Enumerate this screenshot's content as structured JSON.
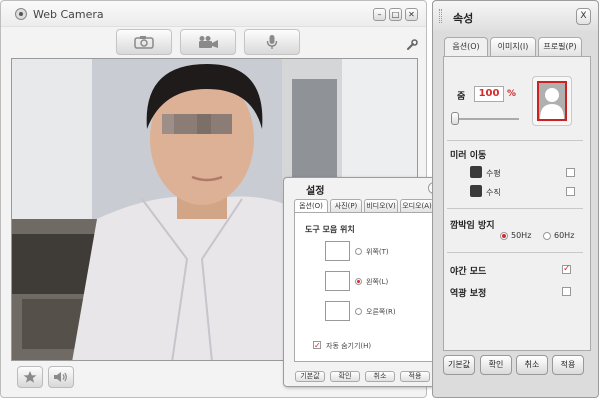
{
  "webcam": {
    "title": "Web Camera",
    "window_buttons": [
      "–",
      "□",
      "✕"
    ],
    "toolbar": {
      "capture_icon": "camera-icon",
      "record_icon": "video-camera-icon",
      "mic_icon": "microphone-icon"
    },
    "settings_icon": "wrench-icon",
    "bottom": {
      "favorite_icon": "star-icon",
      "volume_icon": "speaker-icon"
    }
  },
  "settings": {
    "title": "설정",
    "close": "✕",
    "tabs": [
      "옵션(O)",
      "사진(P)",
      "비디오(V)",
      "오디오(A)"
    ],
    "section": "도구 모음 위치",
    "positions": [
      "위쪽(T)",
      "왼쪽(L)",
      "오른쪽(R)"
    ],
    "selected_position": "왼쪽(L)",
    "auto_hide": "자동 숨기기(H)",
    "auto_hide_checked": true,
    "buttons": [
      "기본값",
      "확인",
      "취소",
      "적용"
    ]
  },
  "props": {
    "title": "속성",
    "close": "X",
    "tabs": [
      "옵션(O)",
      "이미지(I)",
      "프로필(P)"
    ],
    "zoom_label": "줌",
    "zoom_value": "100",
    "zoom_unit": "%",
    "mirror_heading": "미러 이동",
    "horizontal": "수평",
    "vertical": "수직",
    "flicker_heading": "깜박임 방지",
    "hz50": "50Hz",
    "hz60": "60Hz",
    "flicker_selected": "50Hz",
    "night_mode": "야간 모드",
    "night_mode_checked": true,
    "backlight": "역광 보정",
    "backlight_checked": false,
    "buttons": [
      "기본값",
      "확인",
      "취소",
      "적용"
    ],
    "accent_color": "#d42b2b"
  }
}
